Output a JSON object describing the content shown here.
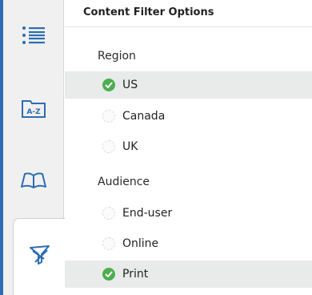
{
  "panel": {
    "title": "Content Filter Options"
  },
  "filters": {
    "region": {
      "label": "Region",
      "options": [
        {
          "label": "US",
          "selected": true
        },
        {
          "label": "Canada",
          "selected": false
        },
        {
          "label": "UK",
          "selected": false
        }
      ]
    },
    "audience": {
      "label": "Audience",
      "options": [
        {
          "label": "End-user",
          "selected": false
        },
        {
          "label": "Online",
          "selected": false
        },
        {
          "label": "Print",
          "selected": true
        }
      ]
    }
  },
  "sidebar": {
    "icons": [
      "toc-list-icon",
      "index-az-icon",
      "book-icon",
      "filter-icon"
    ],
    "active": "filter-icon"
  },
  "colors": {
    "accent": "#2c6db3",
    "selected_bg": "#e9eaea",
    "check_green": "#4caf50"
  }
}
